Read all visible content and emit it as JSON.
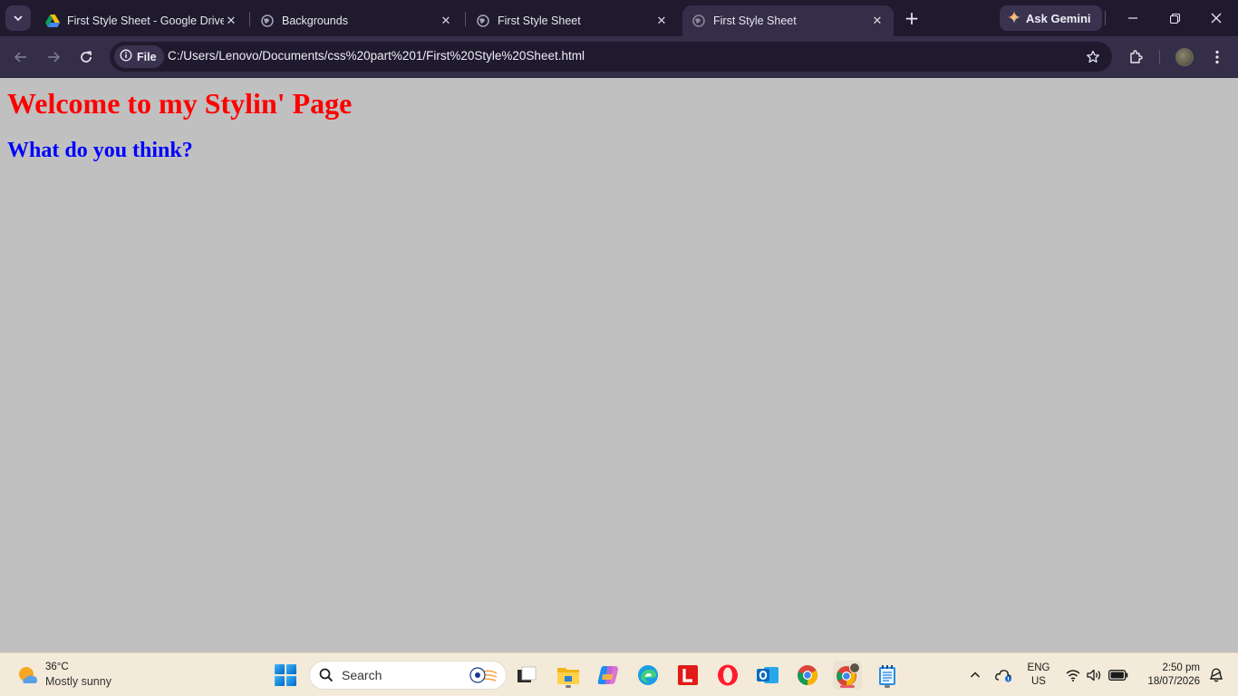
{
  "browser": {
    "tabs": [
      {
        "title": "First Style Sheet - Google Drive",
        "icon": "google-drive-icon",
        "active": false
      },
      {
        "title": "Backgrounds",
        "icon": "globe-icon",
        "active": false
      },
      {
        "title": "First Style Sheet",
        "icon": "globe-icon",
        "active": false
      },
      {
        "title": "First Style Sheet",
        "icon": "globe-icon",
        "active": true
      }
    ],
    "gemini_label": "Ask Gemini",
    "scheme_chip": "File",
    "url": "C:/Users/Lenovo/Documents/css%20part%201/First%20Style%20Sheet.html",
    "theme_colors": {
      "tabstrip": "#1f1a2e",
      "toolbar": "#352e48"
    }
  },
  "page": {
    "heading": "Welcome to my Stylin' Page",
    "subheading": "What do you think?",
    "background_color": "#c0c0c0",
    "heading_color": "#ff0000",
    "subheading_color": "#0000ff"
  },
  "taskbar": {
    "weather": {
      "temp": "36°C",
      "condition": "Mostly sunny"
    },
    "search_placeholder": "Search",
    "apps": [
      "task-view-icon",
      "file-explorer-icon",
      "copilot-icon",
      "edge-icon",
      "l-app-icon",
      "opera-icon",
      "outlook-icon",
      "chrome-icon",
      "chrome-profile-icon",
      "notepad-icon"
    ],
    "language": {
      "line1": "ENG",
      "line2": "US"
    },
    "clock": {
      "time": "2:50 pm",
      "date": "18/07/2026"
    }
  }
}
